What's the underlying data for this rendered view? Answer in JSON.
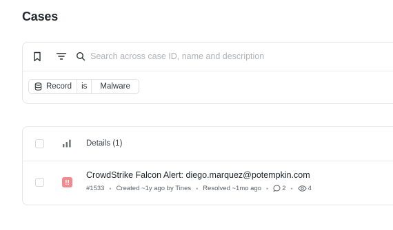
{
  "page": {
    "title": "Cases"
  },
  "search": {
    "placeholder": "Search across case ID, name and description",
    "value": ""
  },
  "filter": {
    "field": "Record",
    "operator": "is",
    "value": "Malware"
  },
  "table": {
    "header_label": "Details (1)",
    "rows": [
      {
        "title": "CrowdStrike Falcon Alert: diego.marquez@potempkin.com",
        "case_id": "#1533",
        "created": "Created ~1y ago by Tines",
        "resolved": "Resolved ~1mo ago",
        "comments": "2",
        "watchers": "4",
        "priority_color": "#f08b8f"
      }
    ]
  },
  "icons": {
    "bookmark": "bookmark-icon",
    "filter": "filter-lines-icon",
    "search": "search-icon",
    "database": "database-icon",
    "sort": "bar-chart-icon",
    "priority": "exclamation-icon",
    "comment": "comment-icon",
    "watchers": "eye-icon"
  }
}
